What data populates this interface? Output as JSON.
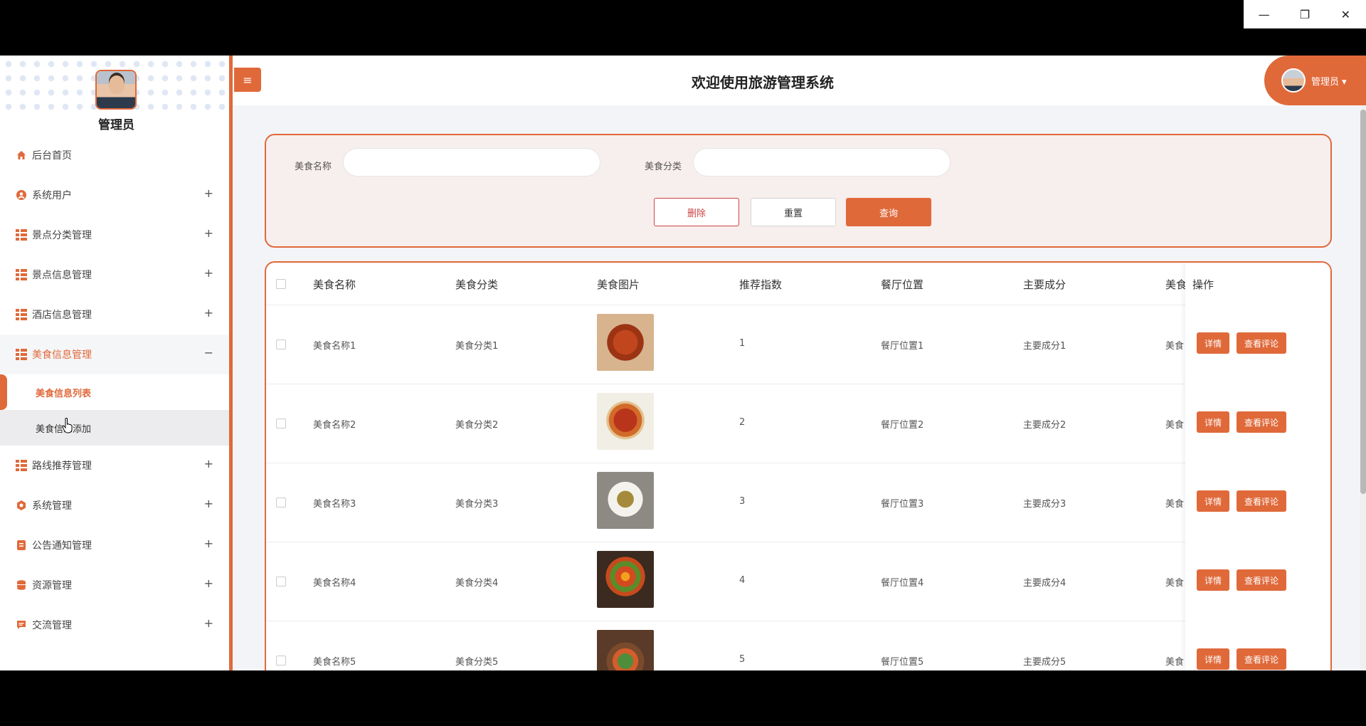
{
  "window": {
    "minimize": "—",
    "restore": "❐",
    "close": "✕"
  },
  "sidebar": {
    "admin_name": "管理员",
    "items": [
      {
        "label": "后台首页",
        "icon": "home-icon",
        "expand": ""
      },
      {
        "label": "系统用户",
        "icon": "user-icon",
        "expand": "+"
      },
      {
        "label": "景点分类管理",
        "icon": "grid-icon",
        "expand": "+"
      },
      {
        "label": "景点信息管理",
        "icon": "grid-icon",
        "expand": "+"
      },
      {
        "label": "酒店信息管理",
        "icon": "grid-icon",
        "expand": "+"
      },
      {
        "label": "美食信息管理",
        "icon": "grid-icon",
        "expand": "−"
      },
      {
        "label": "路线推荐管理",
        "icon": "grid-icon",
        "expand": "+"
      },
      {
        "label": "系统管理",
        "icon": "gear-icon",
        "expand": "+"
      },
      {
        "label": "公告通知管理",
        "icon": "document-icon",
        "expand": "+"
      },
      {
        "label": "资源管理",
        "icon": "database-icon",
        "expand": "+"
      },
      {
        "label": "交流管理",
        "icon": "chat-icon",
        "expand": "+"
      }
    ],
    "subitems": [
      "美食信息列表",
      "美食信息添加"
    ]
  },
  "header": {
    "menu_icon": "≡",
    "title": "欢迎使用旅游管理系统",
    "user_label": "管理员 ▾"
  },
  "search": {
    "name_label": "美食名称",
    "name_value": "",
    "category_label": "美食分类",
    "category_value": "",
    "delete_label": "删除",
    "reset_label": "重置",
    "query_label": "查询"
  },
  "table": {
    "columns": [
      "美食名称",
      "美食分类",
      "美食图片",
      "推荐指数",
      "餐厅位置",
      "主要成分",
      "美食"
    ],
    "op_header": "操作",
    "detail_label": "详情",
    "comments_label": "查看评论",
    "rows": [
      {
        "name": "美食名称1",
        "category": "美食分类1",
        "score": "1",
        "location": "餐厅位置1",
        "ingredients": "主要成分1",
        "extra": "美食"
      },
      {
        "name": "美食名称2",
        "category": "美食分类2",
        "score": "2",
        "location": "餐厅位置2",
        "ingredients": "主要成分2",
        "extra": "美食"
      },
      {
        "name": "美食名称3",
        "category": "美食分类3",
        "score": "3",
        "location": "餐厅位置3",
        "ingredients": "主要成分3",
        "extra": "美食"
      },
      {
        "name": "美食名称4",
        "category": "美食分类4",
        "score": "4",
        "location": "餐厅位置4",
        "ingredients": "主要成分4",
        "extra": "美食"
      },
      {
        "name": "美食名称5",
        "category": "美食分类5",
        "score": "5",
        "location": "餐厅位置5",
        "ingredients": "主要成分5",
        "extra": "美食"
      }
    ]
  },
  "colors": {
    "accent": "#e0693a",
    "danger": "#cc4444"
  }
}
